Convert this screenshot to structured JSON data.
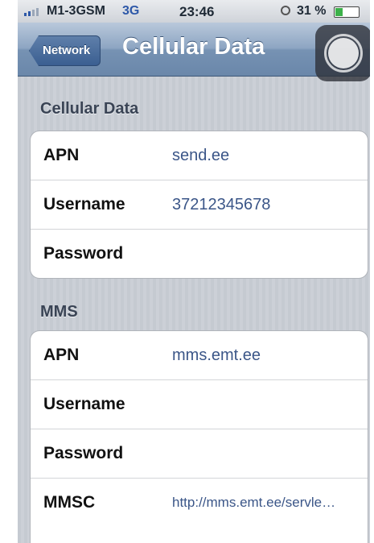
{
  "status_bar": {
    "carrier": "M1-3GSM",
    "network": "3G",
    "time": "23:46",
    "battery_percent": "31 %",
    "battery_level": 0.31,
    "signal_icon": "signal-bars-icon",
    "alarm_icon": "alarm-clock-icon"
  },
  "nav": {
    "back_label": "Network",
    "title": "Cellular Data",
    "assistive_icon": "assistive-touch-icon"
  },
  "cellular": {
    "header": "Cellular Data",
    "rows": [
      {
        "label": "APN",
        "value": "send.ee"
      },
      {
        "label": "Username",
        "value": "37212345678"
      },
      {
        "label": "Password",
        "value": ""
      }
    ]
  },
  "mms": {
    "header": "MMS",
    "rows": [
      {
        "label": "APN",
        "value": "mms.emt.ee"
      },
      {
        "label": "Username",
        "value": ""
      },
      {
        "label": "Password",
        "value": ""
      },
      {
        "label": "MMSC",
        "value": "http://mms.emt.ee/servle…"
      }
    ]
  },
  "colors": {
    "nav_bar": "#6a87aa",
    "value_text": "#3b5688",
    "background": "#c8ccd3"
  }
}
